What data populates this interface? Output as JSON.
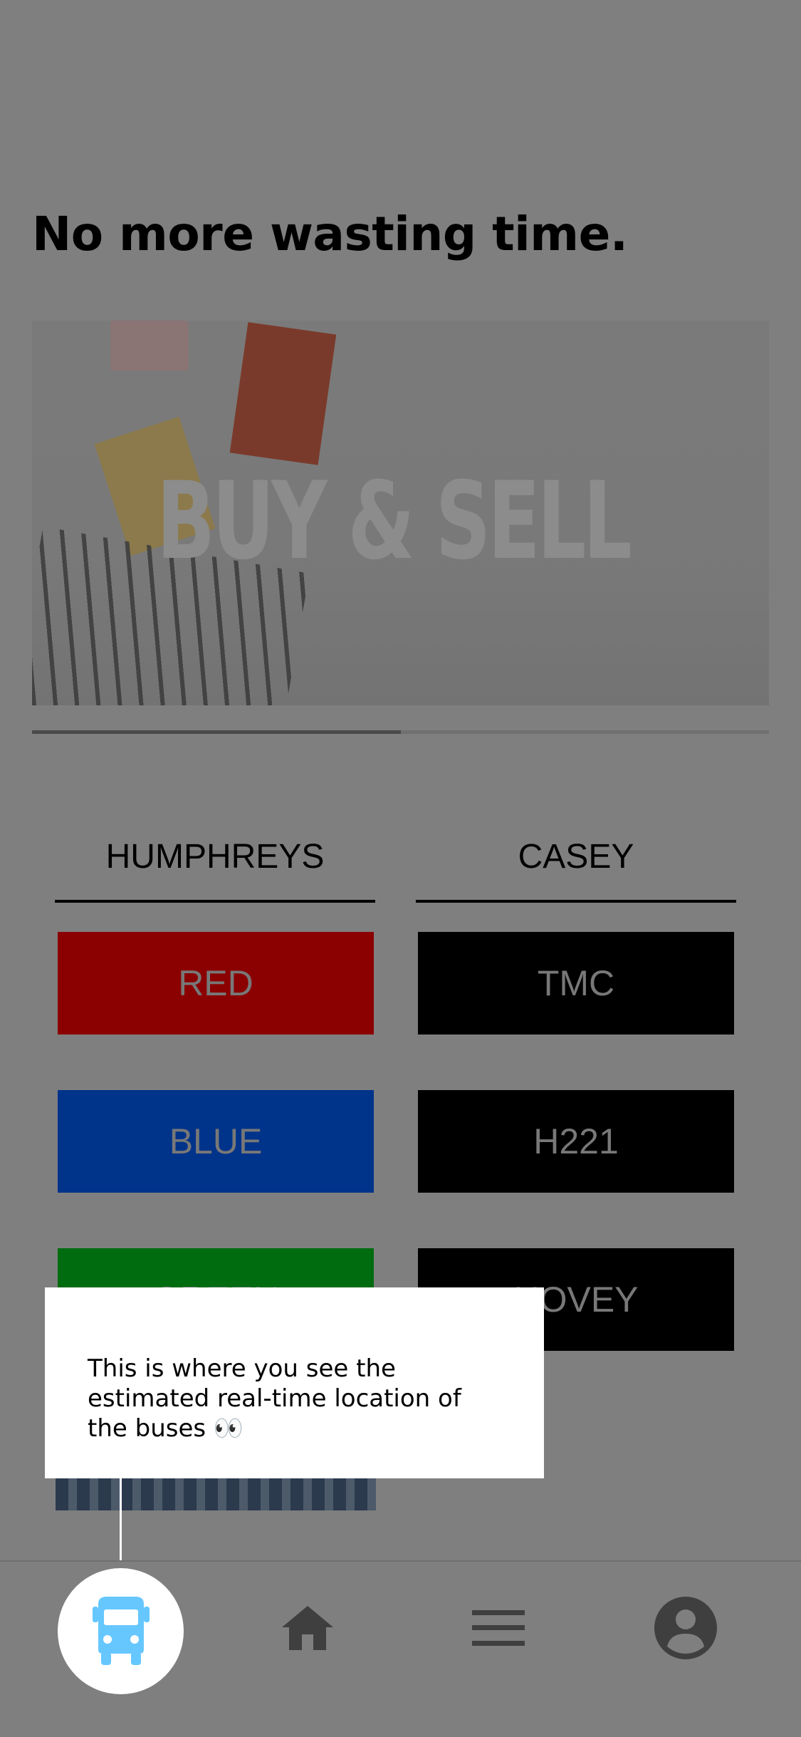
{
  "headline": "No more wasting time.",
  "banner": {
    "text": "BUY & SELL",
    "slide_progress": 0.5
  },
  "columns": [
    {
      "name": "HUMPHREYS",
      "routes": [
        {
          "label": "RED",
          "color": "#8b0000"
        },
        {
          "label": "BLUE",
          "color": "#00338a"
        },
        {
          "label": "GREEN",
          "color": "#006c10"
        }
      ]
    },
    {
      "name": "CASEY",
      "routes": [
        {
          "label": "TMC",
          "color": "#000000"
        },
        {
          "label": "H221",
          "color": "#000000"
        },
        {
          "label": "HOVEY",
          "color": "#000000"
        }
      ]
    }
  ],
  "tooltip": {
    "text": "This is where you see the estimated real-time location of the buses 👀"
  },
  "tab_bar": {
    "tabs": [
      {
        "icon": "bus-icon",
        "active": true,
        "active_color": "#66c7ff"
      },
      {
        "icon": "home-icon"
      },
      {
        "icon": "menu-icon"
      },
      {
        "icon": "account-icon"
      }
    ],
    "icon_color": "#3f3f3f"
  },
  "colors": {
    "overlay_background": "#7f7f7f",
    "tooltip_background": "#ffffff"
  }
}
